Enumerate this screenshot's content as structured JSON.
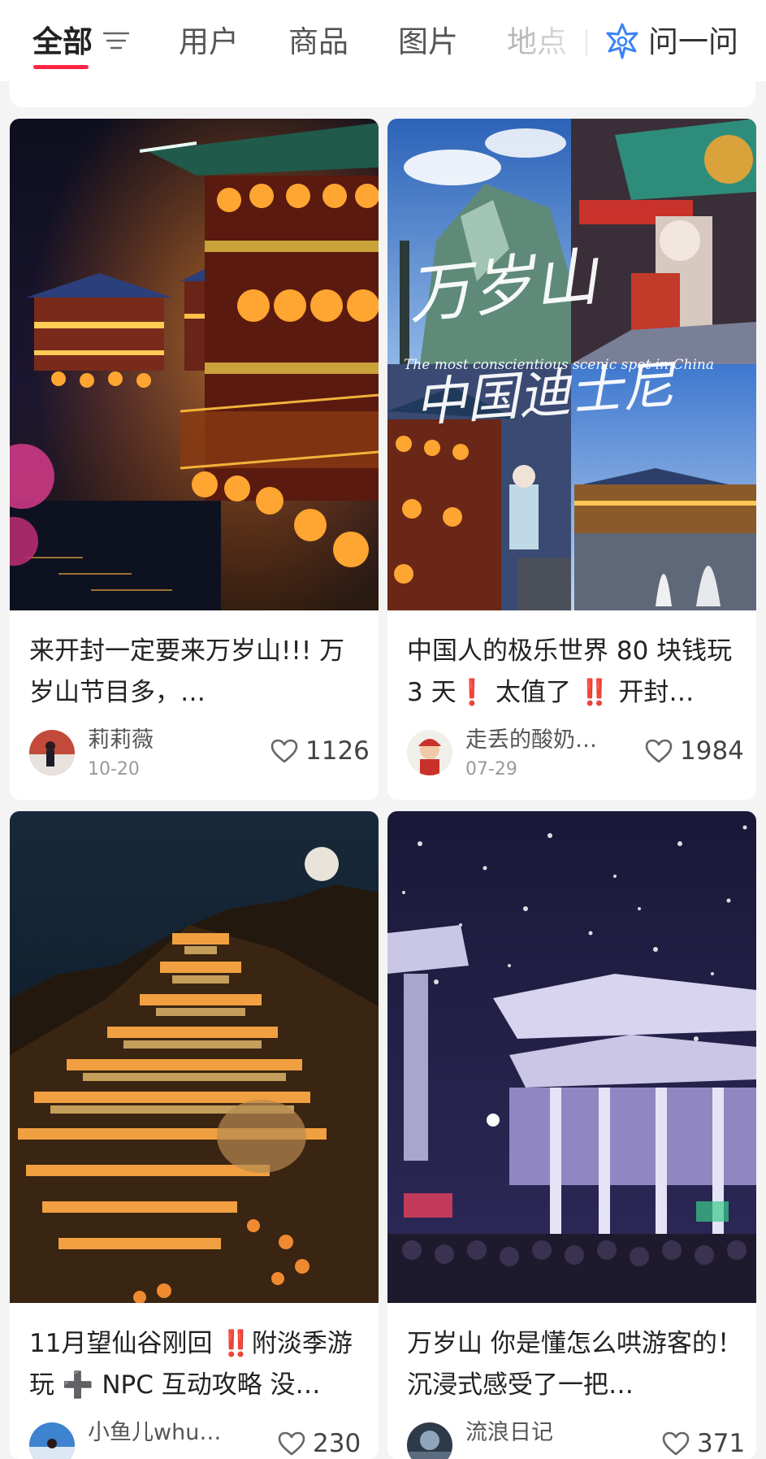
{
  "tabs": [
    {
      "label": "全部",
      "active": true
    },
    {
      "label": "用户"
    },
    {
      "label": "商品"
    },
    {
      "label": "图片"
    },
    {
      "label": "地点"
    }
  ],
  "ask": {
    "label": "问一问"
  },
  "icons": {
    "filter": "filter-lines-icon",
    "ask": "ai-star-icon",
    "like": "heart-outline-icon"
  },
  "colors": {
    "accent": "#ff2442",
    "emphasis": "#e8272f"
  },
  "cards": [
    {
      "title": "来开封一定要来万岁山!!! 万岁山节目多，…",
      "author": "莉莉薇",
      "date": "10-20",
      "likes": "1126"
    },
    {
      "title_start": "中国人的极乐世界 80 块钱玩 3 天",
      "title_mark1": "❗",
      "title_mid": " 太值了 ",
      "title_mark2": "‼️",
      "title_end": " 开封…",
      "image_text_main": "万岁山",
      "image_text_sub": "The most conscientious scenic spot in China",
      "image_text_second": "中国迪士尼",
      "author": "走丢的酸奶…",
      "date": "07-29",
      "likes": "1984"
    },
    {
      "title_start": "11月望仙谷刚回 ",
      "title_mark1": "‼️",
      "title_mid": "附淡季游玩 ",
      "title_mark2": "➕",
      "title_end": " NPC 互动攻略 没…",
      "author": "小鱼儿whu乖乖",
      "likes": "230"
    },
    {
      "title": "万岁山 你是懂怎么哄游客的！ 沉浸式感受了一把…",
      "author": "流浪日记",
      "likes": "371"
    }
  ]
}
